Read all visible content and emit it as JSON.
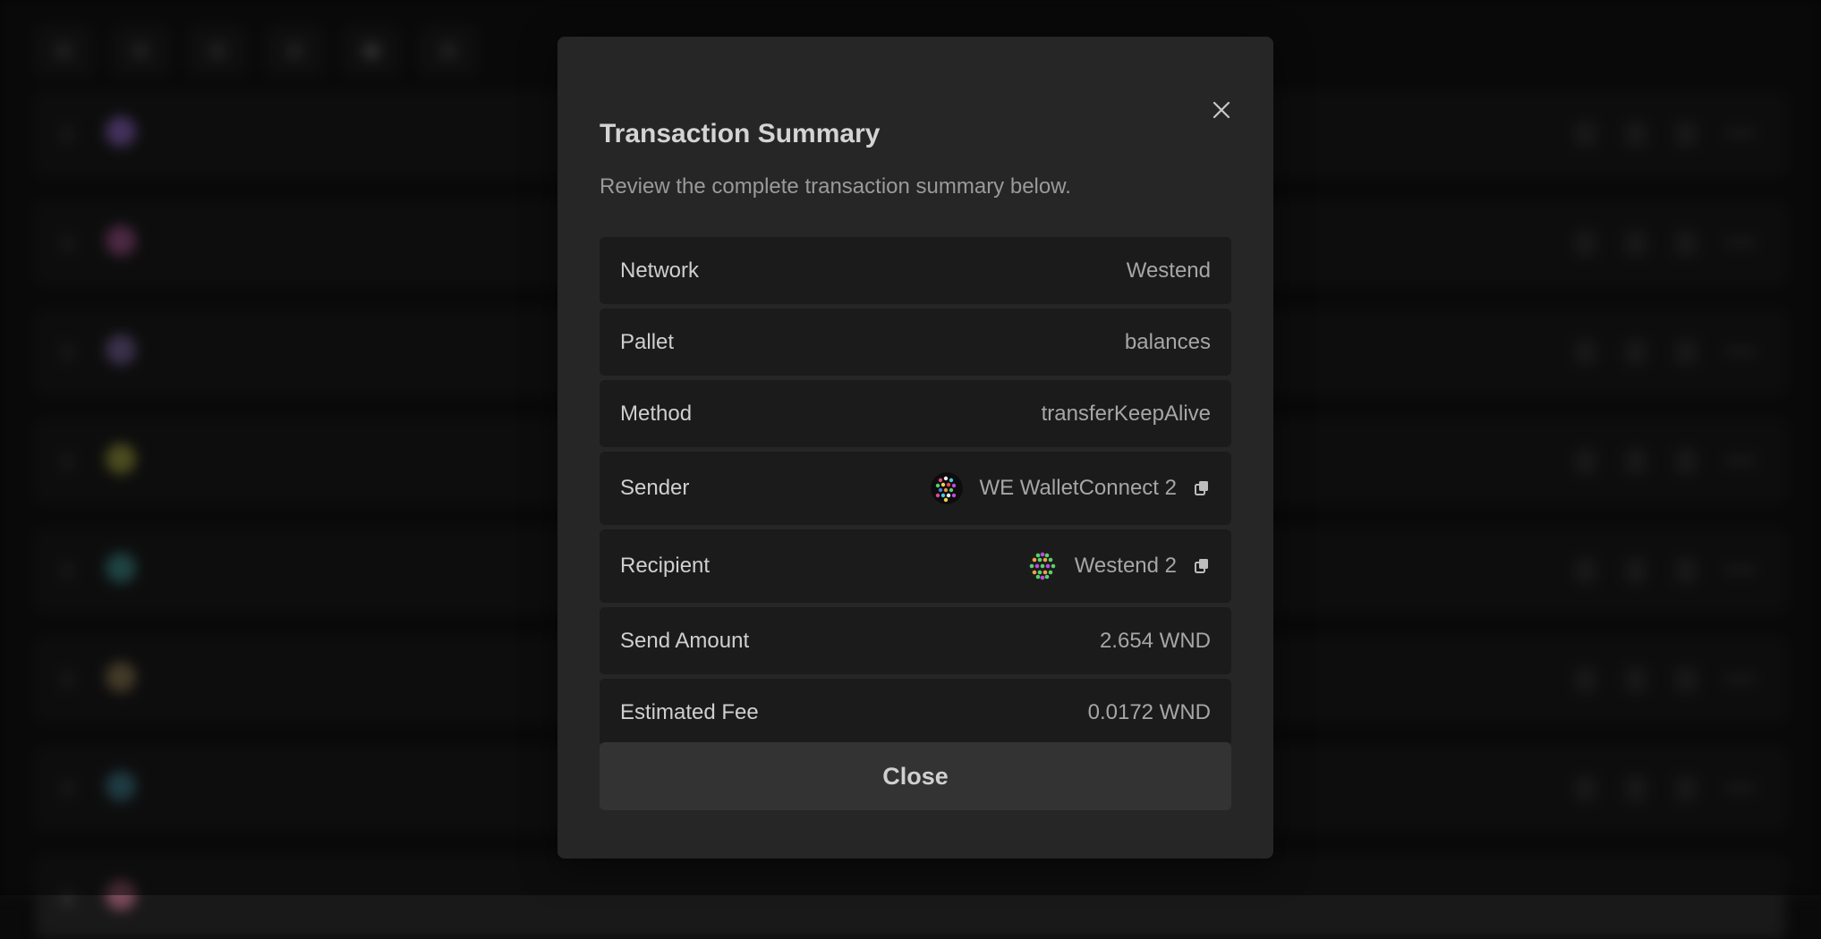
{
  "modal": {
    "title": "Transaction Summary",
    "description": "Review the complete transaction summary below.",
    "close_button_label": "Close",
    "close_icon": "close-icon"
  },
  "summary": {
    "network": {
      "label": "Network",
      "value": "Westend"
    },
    "pallet": {
      "label": "Pallet",
      "value": "balances"
    },
    "method": {
      "label": "Method",
      "value": "transferKeepAlive"
    },
    "sender": {
      "label": "Sender",
      "value": "WE WalletConnect 2",
      "icon": "copy-icon"
    },
    "recipient": {
      "label": "Recipient",
      "value": "Westend 2",
      "icon": "copy-icon"
    },
    "send_amount": {
      "label": "Send Amount",
      "value": "2.654 WND"
    },
    "estimated_fee": {
      "label": "Estimated Fee",
      "value": "0.0172 WND"
    }
  },
  "colors": {
    "modal_bg": "#262626",
    "row_bg": "#1b1b1b",
    "button_bg": "#333333",
    "label_text": "#cfcfcf",
    "value_text": "#a6a6a6"
  }
}
